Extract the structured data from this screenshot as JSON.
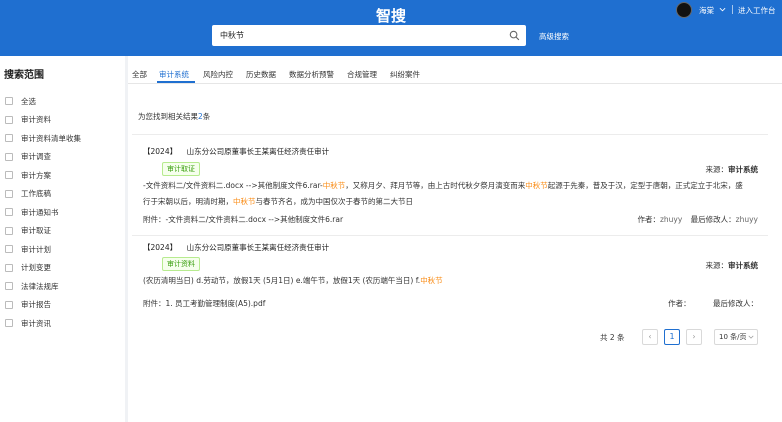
{
  "header": {
    "brand": "智搜",
    "search_value": "中秋节",
    "advanced_search": "高级搜索",
    "user_name": "海棠",
    "workbench": "进入工作台"
  },
  "sidebar": {
    "title": "搜索范围",
    "items": [
      {
        "label": "全选"
      },
      {
        "label": "审计资料"
      },
      {
        "label": "审计资料清单收集"
      },
      {
        "label": "审计调查"
      },
      {
        "label": "审计方案"
      },
      {
        "label": "工作底稿"
      },
      {
        "label": "审计通知书"
      },
      {
        "label": "审计取证"
      },
      {
        "label": "审计计划"
      },
      {
        "label": "计划变更"
      },
      {
        "label": "法律法规库"
      },
      {
        "label": "审计报告"
      },
      {
        "label": "审计资讯"
      }
    ]
  },
  "tabs": [
    "全部",
    "审计系统",
    "风险内控",
    "历史数据",
    "数据分析预警",
    "合规管理",
    "纠纷案件"
  ],
  "results": {
    "prefix": "为您找到相关结果",
    "count": "2",
    "suffix": "条"
  },
  "cards": [
    {
      "year": "【2024】",
      "title": "山东分公司原董事长王某离任经济责任审计",
      "tag": "审计取证",
      "source_label": "来源：",
      "source_value": "审计系统",
      "excerpt_1a": "-文件资料二/文件资料二.docx -->其他制度文件6.rar-",
      "hl_1": "中秋节",
      "excerpt_1b": "，又称月夕、拜月节等，由上古时代秋夕祭月演变而来",
      "hl_2": "中秋节",
      "excerpt_1c": "起源于先秦，普及于汉，定型于唐朝，正式定立于北宋，盛",
      "excerpt_2a": "行于宋朝以后，明清时期，",
      "hl_3": "中秋节",
      "excerpt_2b": "与春节齐名，成为中国仅次于春节的第二大节日",
      "attach_label": "附件：",
      "attach_value": "-文件资料二/文件资料二.docx -->其他制度文件6.rar",
      "author_label": "作者：",
      "author": "zhuyy",
      "modifier_label": "最后修改人：",
      "modifier": "zhuyy"
    },
    {
      "year": "【2024】",
      "title": "山东分公司原董事长王某离任经济责任审计",
      "tag": "审计资料",
      "source_label": "来源：",
      "source_value": "审计系统",
      "excerpt_a": "(农历清明当日) d.劳动节，放假1天 (5月1日) e.端午节，放假1天 (农历端午当日) f.",
      "hl_1": "中秋节",
      "attach_label": "附件：",
      "attach_value": "1. 员工考勤管理制度(A5).pdf",
      "author_label": "作者：",
      "author": "",
      "modifier_label": "最后修改人：",
      "modifier": ""
    }
  ],
  "pagination": {
    "total": "共 2 条",
    "current": "1",
    "page_size": "10 条/页",
    "prev": "‹",
    "next": "›"
  },
  "colors": {
    "primary": "#1f6fd0",
    "highlight": "#fa8c16",
    "tag_green": "#389e0d"
  }
}
